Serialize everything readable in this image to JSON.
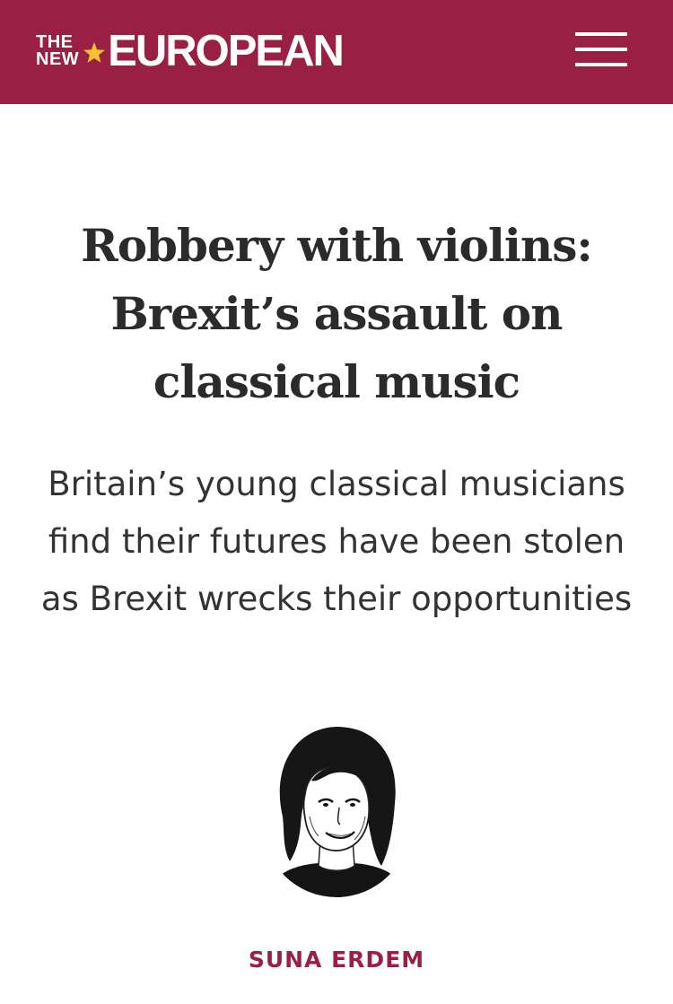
{
  "header": {
    "logo_the": "THE",
    "logo_new": "NEW",
    "logo_main": "EUROPEAN",
    "menu_icon": "hamburger-menu-icon",
    "brand_color": "#9a1f45",
    "star_color": "#f2c230"
  },
  "article": {
    "headline": "Robbery with violins: Brexit’s assault on classical music",
    "standfirst": "Britain’s young classical musicians find their futures have been stolen as Brexit wrecks their opportunities",
    "author_avatar": "author-portrait-illustration",
    "author": "SUNA ERDEM"
  }
}
